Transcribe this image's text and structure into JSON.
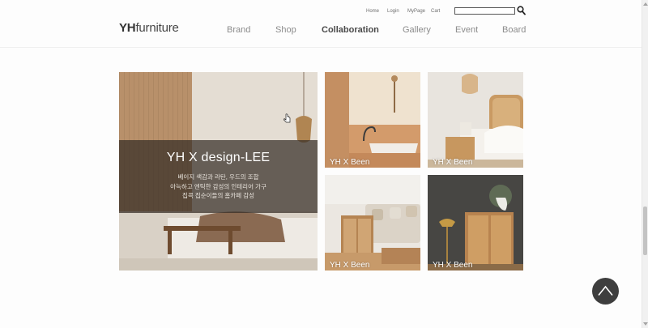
{
  "header": {
    "logo": {
      "bold": "YH",
      "rest": "furniture"
    },
    "util_nav": [
      "Home",
      "Login",
      "MyPage",
      "Cart"
    ],
    "search": {
      "placeholder": "",
      "value": "",
      "icon": "search-icon"
    },
    "main_nav": [
      {
        "label": "Brand",
        "active": false
      },
      {
        "label": "Shop",
        "active": false
      },
      {
        "label": "Collaboration",
        "active": true
      },
      {
        "label": "Gallery",
        "active": false
      },
      {
        "label": "Event",
        "active": false
      },
      {
        "label": "Board",
        "active": false
      }
    ]
  },
  "gallery": {
    "hero": {
      "title": "YH X design-LEE",
      "lines": [
        "베이지 색감과 라탄, 우드의 조합",
        "아늑하고 엔틱한 감성의 인테리어 가구",
        "집콕 집순이들의 홈카페 감성"
      ]
    },
    "tiles": [
      {
        "caption": "YH X Been"
      },
      {
        "caption": "YH X Been"
      },
      {
        "caption": "YH X Been"
      },
      {
        "caption": "YH X Been"
      }
    ]
  },
  "scroll_top": {
    "icon": "chevron-up-icon"
  },
  "colors": {
    "accent_dark": "#3e3e3e",
    "overlay": "#342d26",
    "text_nav": "#8c8c8c",
    "text_active": "#4a4a4a"
  }
}
